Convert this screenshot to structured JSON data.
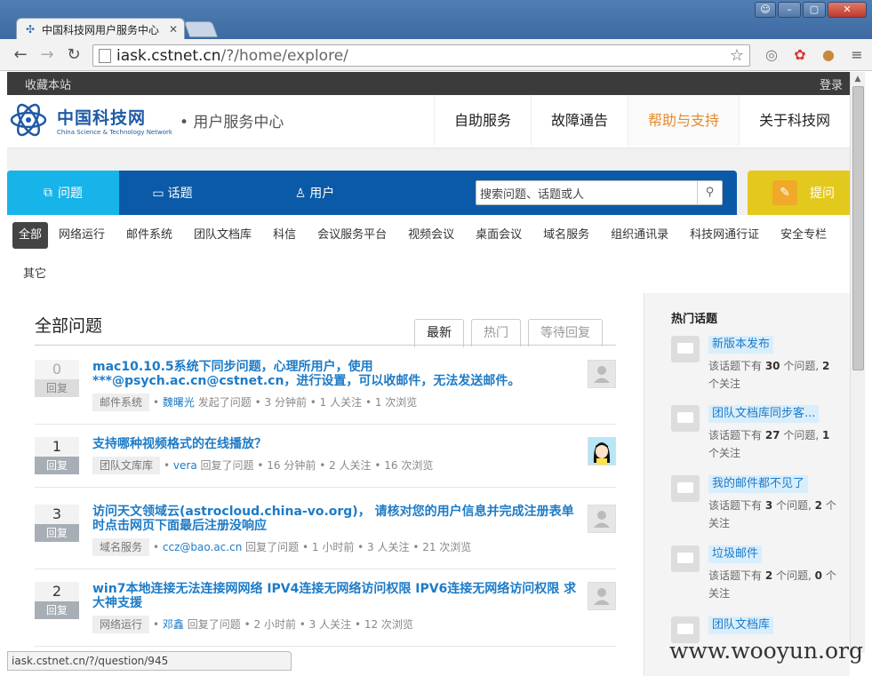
{
  "browser": {
    "tab_title": "中国科技网用户服务中心",
    "url_host": "iask.cstnet.cn",
    "url_path": "/?/home/explore/",
    "status_url": "iask.cstnet.cn/?/question/945"
  },
  "topbar": {
    "bookmark": "收藏本站",
    "login": "登录"
  },
  "header": {
    "logo_cn": "中国科技网",
    "logo_en": "China Science & Technology Network",
    "subtitle": "• 用户服务中心",
    "nav": [
      "自助服务",
      "故障通告",
      "帮助与支持",
      "关于科技网"
    ],
    "nav_active": 2
  },
  "tabs": {
    "questions": "问题",
    "topics": "话题",
    "users": "用户",
    "ask": "提问"
  },
  "search": {
    "placeholder": "搜索问题、话题或人"
  },
  "categories": [
    "全部",
    "网络运行",
    "邮件系统",
    "团队文档库",
    "科信",
    "会议服务平台",
    "视频会议",
    "桌面会议",
    "域名服务",
    "组织通讯录",
    "科技网通行证",
    "安全专栏",
    "其它"
  ],
  "main": {
    "title": "全部问题",
    "filters": [
      "最新",
      "热门",
      "等待回复"
    ],
    "reply_label": "回复",
    "questions": [
      {
        "count": "0",
        "title": "mac10.10.5系统下同步问题，心理所用户，使用***@psych.ac.cn@cstnet.cn，进行设置，可以收邮件，无法发送邮件。",
        "tag": "邮件系统",
        "user": "魏曙光",
        "action": "发起了问题",
        "time": "• 3 分钟前",
        "follows": "• 1 人关注",
        "views": "• 1 次浏览"
      },
      {
        "count": "1",
        "title": "支持哪种视频格式的在线播放？",
        "tag": "团队文库库",
        "user": "vera",
        "action": "回复了问题",
        "time": "• 16 分钟前",
        "follows": "• 2 人关注",
        "views": "• 16 次浏览"
      },
      {
        "count": "3",
        "title": "访问天文领域云(astrocloud.china-vo.org)， 请核对您的用户信息并完成注册表单时点击网页下面最后注册没响应",
        "tag": "域名服务",
        "user": "ccz@bao.ac.cn",
        "action": "回复了问题",
        "time": "• 1 小时前",
        "follows": "• 3 人关注",
        "views": "• 21 次浏览"
      },
      {
        "count": "2",
        "title": "win7本地连接无法连接网网络 IPV4连接无网络访问权限 IPV6连接无网络访问权限 求大神支援",
        "tag": "网络运行",
        "user": "邓鑫",
        "action": "回复了问题",
        "time": "• 2 小时前",
        "follows": "• 3 人关注",
        "views": "• 12 次浏览"
      }
    ]
  },
  "sidebar": {
    "title": "热门话题",
    "topics": [
      {
        "name": "新版本发布",
        "pre": "该话题下有 ",
        "q": "30",
        "mid": " 个问题, ",
        "f": "2",
        "post": " 个关注"
      },
      {
        "name": "团队文档库同步客...",
        "pre": "该话题下有 ",
        "q": "27",
        "mid": " 个问题, ",
        "f": "1",
        "post": " 个关注"
      },
      {
        "name": "我的邮件都不见了",
        "pre": "该话题下有 ",
        "q": "3",
        "mid": " 个问题, ",
        "f": "2",
        "post": " 个关注"
      },
      {
        "name": "垃圾邮件",
        "pre": "该话题下有 ",
        "q": "2",
        "mid": " 个问题, ",
        "f": "0",
        "post": " 个关注"
      },
      {
        "name": "团队文档库",
        "pre": "",
        "q": "",
        "mid": "",
        "f": "",
        "post": ""
      }
    ]
  },
  "watermark": "www.wooyun.org"
}
